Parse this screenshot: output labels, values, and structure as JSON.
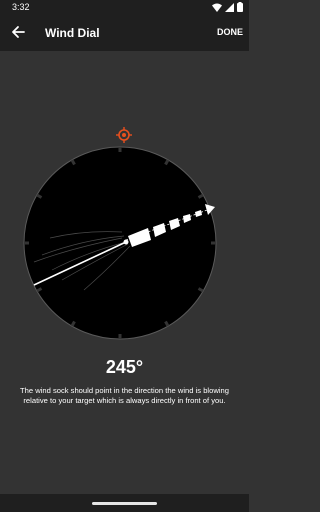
{
  "status_bar": {
    "time": "3:32",
    "icons": [
      "wifi-icon",
      "signal-icon",
      "battery-icon"
    ]
  },
  "app_bar": {
    "title": "Wind Dial",
    "back_icon": "arrow-back-icon",
    "done_label": "DONE"
  },
  "dial": {
    "direction_degrees": 245,
    "target_icon": "crosshair-target-icon",
    "target_color": "#e8501e",
    "dial_color": "#000000",
    "sock_color": "#ffffff"
  },
  "heading": {
    "value": "245°"
  },
  "instructions": {
    "text": "The wind sock should point in the direction the wind is blowing relative to your target which is always directly in front of you."
  },
  "colors": {
    "background": "#333333",
    "app_bar": "#1f1f1f",
    "text": "#ffffff"
  }
}
